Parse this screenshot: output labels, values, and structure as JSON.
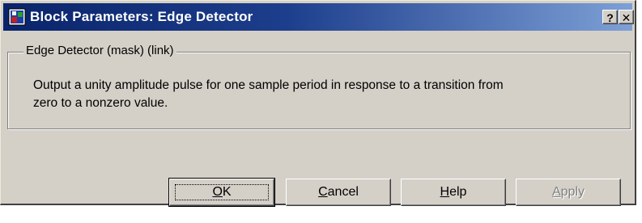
{
  "window": {
    "title": "Block Parameters: Edge Detector",
    "caption_help": "?",
    "caption_close": "✕"
  },
  "group": {
    "legend": "Edge Detector (mask) (link)",
    "description": "Output a unity amplitude pulse for one sample period in response to a transition from\n zero to a nonzero value."
  },
  "buttons": {
    "ok": {
      "mnemonic": "O",
      "rest": "K"
    },
    "cancel": {
      "mnemonic": "C",
      "rest": "ancel"
    },
    "help": {
      "mnemonic": "H",
      "rest": "elp"
    },
    "apply": {
      "mnemonic": "A",
      "rest": "pply",
      "enabled": false
    }
  },
  "colors": {
    "title_gradient_start": "#0a246a",
    "title_gradient_end": "#7ea0d6",
    "face": "#d4d0c8"
  }
}
